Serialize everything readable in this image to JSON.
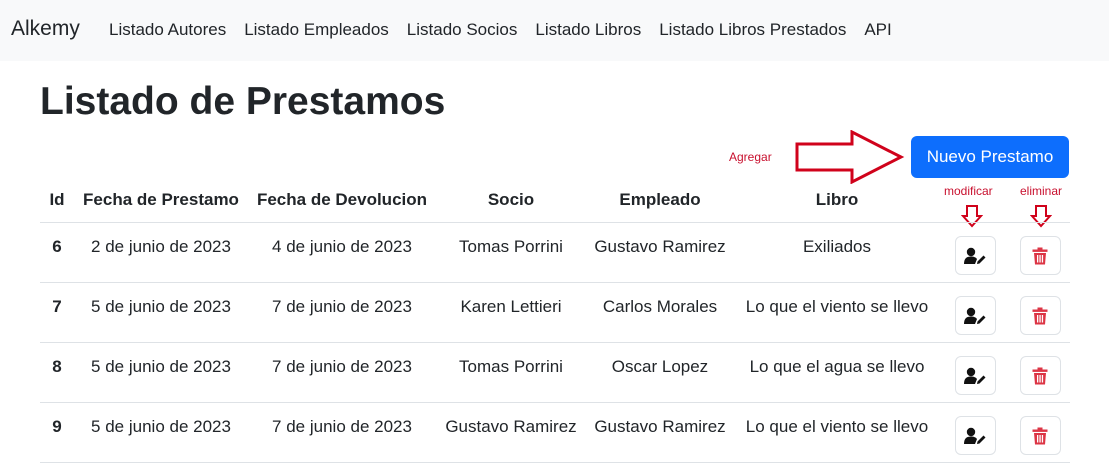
{
  "nav": {
    "brand": "Alkemy",
    "links": [
      "Listado Autores",
      "Listado Empleados",
      "Listado Socios",
      "Listado Libros",
      "Listado Libros Prestados",
      "API"
    ]
  },
  "page": {
    "title": "Listado de Prestamos",
    "new_button": "Nuevo Prestamo"
  },
  "annotations": {
    "add": "Agregar",
    "modify": "modificar",
    "delete": "eliminar"
  },
  "table": {
    "headers": [
      "Id",
      "Fecha de Prestamo",
      "Fecha de Devolucion",
      "Socio",
      "Empleado",
      "Libro"
    ],
    "rows": [
      [
        "6",
        "2 de junio de 2023",
        "4 de junio de 2023",
        "Tomas Porrini",
        "Gustavo Ramirez",
        "Exiliados"
      ],
      [
        "7",
        "5 de junio de 2023",
        "7 de junio de 2023",
        "Karen Lettieri",
        "Carlos Morales",
        "Lo que el viento se llevo"
      ],
      [
        "8",
        "5 de junio de 2023",
        "7 de junio de 2023",
        "Tomas Porrini",
        "Oscar Lopez",
        "Lo que el agua se llevo"
      ],
      [
        "9",
        "5 de junio de 2023",
        "7 de junio de 2023",
        "Gustavo Ramirez",
        "Gustavo Ramirez",
        "Lo que el viento se llevo"
      ]
    ]
  },
  "icons": {
    "edit": "user-edit-icon",
    "delete": "trash-icon"
  },
  "colors": {
    "primary": "#0d6efd",
    "danger": "#dc3545",
    "annotation": "#c8102e"
  }
}
